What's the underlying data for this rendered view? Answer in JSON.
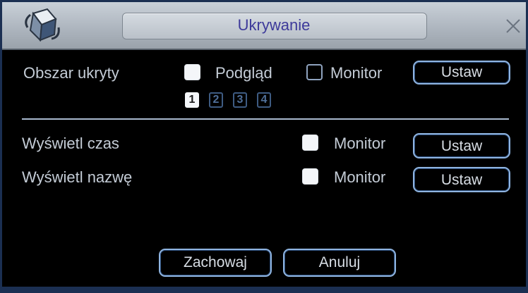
{
  "window": {
    "title": "Ukrywanie"
  },
  "hidden_area": {
    "label": "Obszar ukryty",
    "preview_checked": true,
    "preview_label": "Podgląd",
    "monitor_checked": false,
    "monitor_label": "Monitor",
    "set_label": "Ustaw",
    "pages": [
      "1",
      "2",
      "3",
      "4"
    ],
    "active_page": "1"
  },
  "show_time": {
    "label": "Wyświetl czas",
    "monitor_checked": true,
    "monitor_label": "Monitor",
    "set_label": "Ustaw"
  },
  "show_name": {
    "label": "Wyświetl nazwę",
    "monitor_checked": true,
    "monitor_label": "Monitor",
    "set_label": "Ustaw"
  },
  "footer": {
    "save_label": "Zachowaj",
    "cancel_label": "Anuluj"
  },
  "colors": {
    "title_text": "#3d3a9a",
    "label_text": "#c4ccd6",
    "button_border": "#8fb4e0",
    "window_border": "#1b2f52"
  },
  "icons": {
    "logo": "cube-logo-icon",
    "close": "close-icon"
  }
}
